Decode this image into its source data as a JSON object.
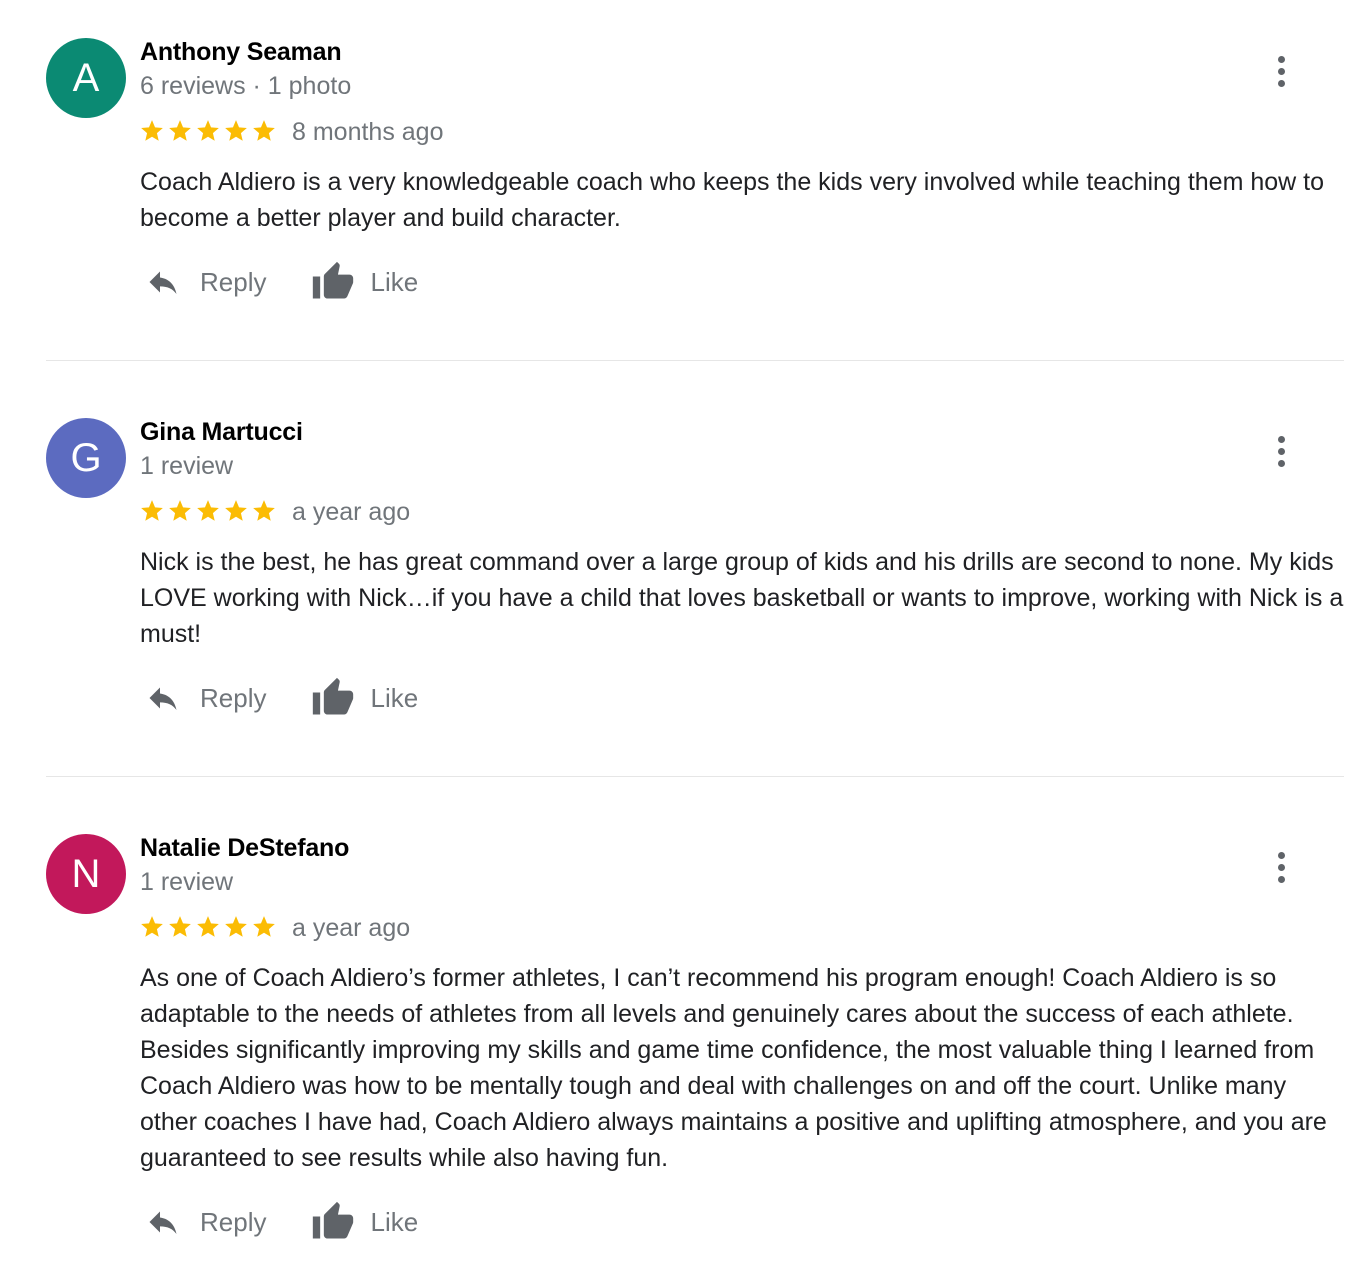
{
  "colors": {
    "star": "#fbbc04",
    "muted_text": "#70757a",
    "icon": "#5f6368"
  },
  "icons": {
    "star": "star-icon",
    "reply": "reply-icon",
    "like": "thumbs-up-icon",
    "more": "more-vert-icon"
  },
  "reviews": [
    {
      "initial": "A",
      "avatar_color": "#0b8a73",
      "name": "Anthony Seaman",
      "meta": "6 reviews · 1 photo",
      "rating": 5,
      "age": "8 months ago",
      "text": "Coach Aldiero is a very knowledgeable coach who keeps the kids very involved while teaching them how to become a better player and build character.",
      "reply_label": "Reply",
      "like_label": "Like"
    },
    {
      "initial": "G",
      "avatar_color": "#5c6bc0",
      "name": "Gina Martucci",
      "meta": "1 review",
      "rating": 5,
      "age": "a year ago",
      "text": "Nick is the best, he has great command over a large group of kids and his drills are second to none. My kids LOVE working with Nick…if you have a child that loves basketball or wants to improve, working with Nick is a must!",
      "reply_label": "Reply",
      "like_label": "Like"
    },
    {
      "initial": "N",
      "avatar_color": "#c2185b",
      "name": "Natalie DeStefano",
      "meta": "1 review",
      "rating": 5,
      "age": "a year ago",
      "text": "As one of Coach Aldiero’s former athletes, I can’t recommend his program enough! Coach Aldiero is so adaptable to the needs of athletes from all levels and genuinely cares about the success of each athlete. Besides significantly improving my skills and game time confidence, the most valuable thing I learned from Coach Aldiero was how to be mentally tough and deal with challenges on and off the court. Unlike many other coaches I have had, Coach Aldiero always maintains a positive and uplifting atmosphere, and you are guaranteed to see results while also having fun.",
      "reply_label": "Reply",
      "like_label": "Like"
    }
  ]
}
